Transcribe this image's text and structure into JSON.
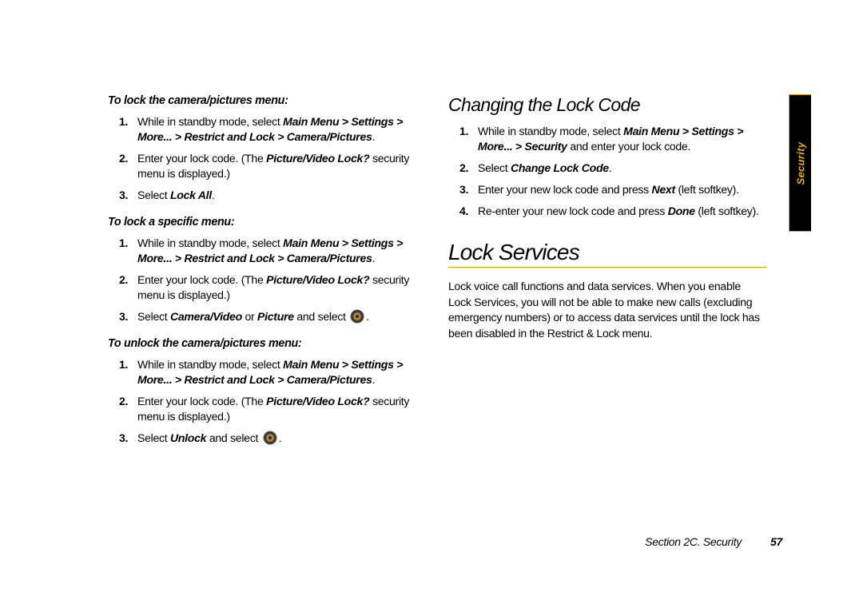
{
  "tab": {
    "label": "Security"
  },
  "footer": {
    "section": "Section 2C. Security",
    "page": "57"
  },
  "left": {
    "task1": {
      "heading": "To lock the camera/pictures menu:",
      "steps": [
        {
          "n": "1.",
          "a": "While in standby mode, select ",
          "b": "Main Menu > Settings > More... > Restrict and Lock > Camera/Pictures",
          "c": "."
        },
        {
          "n": "2.",
          "a": "Enter your lock code. (The ",
          "b": "Picture/Video Lock?",
          "c": " security menu is displayed.)"
        },
        {
          "n": "3.",
          "a": "Select ",
          "b": "Lock All",
          "c": "."
        }
      ]
    },
    "task2": {
      "heading": "To lock a specific menu:",
      "steps": [
        {
          "n": "1.",
          "a": "While in standby mode, select ",
          "b": "Main Menu > Settings > More... > Restrict and Lock > Camera/Pictures",
          "c": "."
        },
        {
          "n": "2.",
          "a": "Enter your lock code. (The ",
          "b": "Picture/Video Lock?",
          "c": " security menu is displayed.)"
        },
        {
          "n": "3.",
          "a": "Select ",
          "b": "Camera/Video",
          "c": " or ",
          "d": "Picture",
          "e": " and select ",
          "icon": "ok",
          "f": "."
        }
      ]
    },
    "task3": {
      "heading": "To unlock the camera/pictures menu:",
      "steps": [
        {
          "n": "1.",
          "a": "While in standby mode, select ",
          "b": "Main Menu > Settings > More... > Restrict and Lock > Camera/Pictures",
          "c": "."
        },
        {
          "n": "2.",
          "a": "Enter your lock code. (The ",
          "b": "Picture/Video Lock?",
          "c": " security menu is displayed.)"
        },
        {
          "n": "3.",
          "a": "Select ",
          "b": "Unlock",
          "c": " and select ",
          "icon": "ok",
          "d": "."
        }
      ]
    }
  },
  "right": {
    "h2": "Changing the Lock Code",
    "steps": [
      {
        "n": "1.",
        "a": "While in standby mode, select ",
        "b": "Main Menu > Settings > More... > Security",
        "c": " and enter your lock code."
      },
      {
        "n": "2.",
        "a": "Select ",
        "b": "Change Lock Code",
        "c": "."
      },
      {
        "n": "3.",
        "a": "Enter your new lock code and press ",
        "b": "Next",
        "c": " (left softkey)."
      },
      {
        "n": "4.",
        "a": "Re-enter your new lock code and press ",
        "b": "Done",
        "c": " (left softkey)."
      }
    ],
    "h1": "Lock Services",
    "para": "Lock voice call functions and data services. When you enable Lock Services, you will not be able to make new calls (excluding emergency numbers) or to access data services until the lock has been disabled in the Restrict & Lock menu."
  }
}
